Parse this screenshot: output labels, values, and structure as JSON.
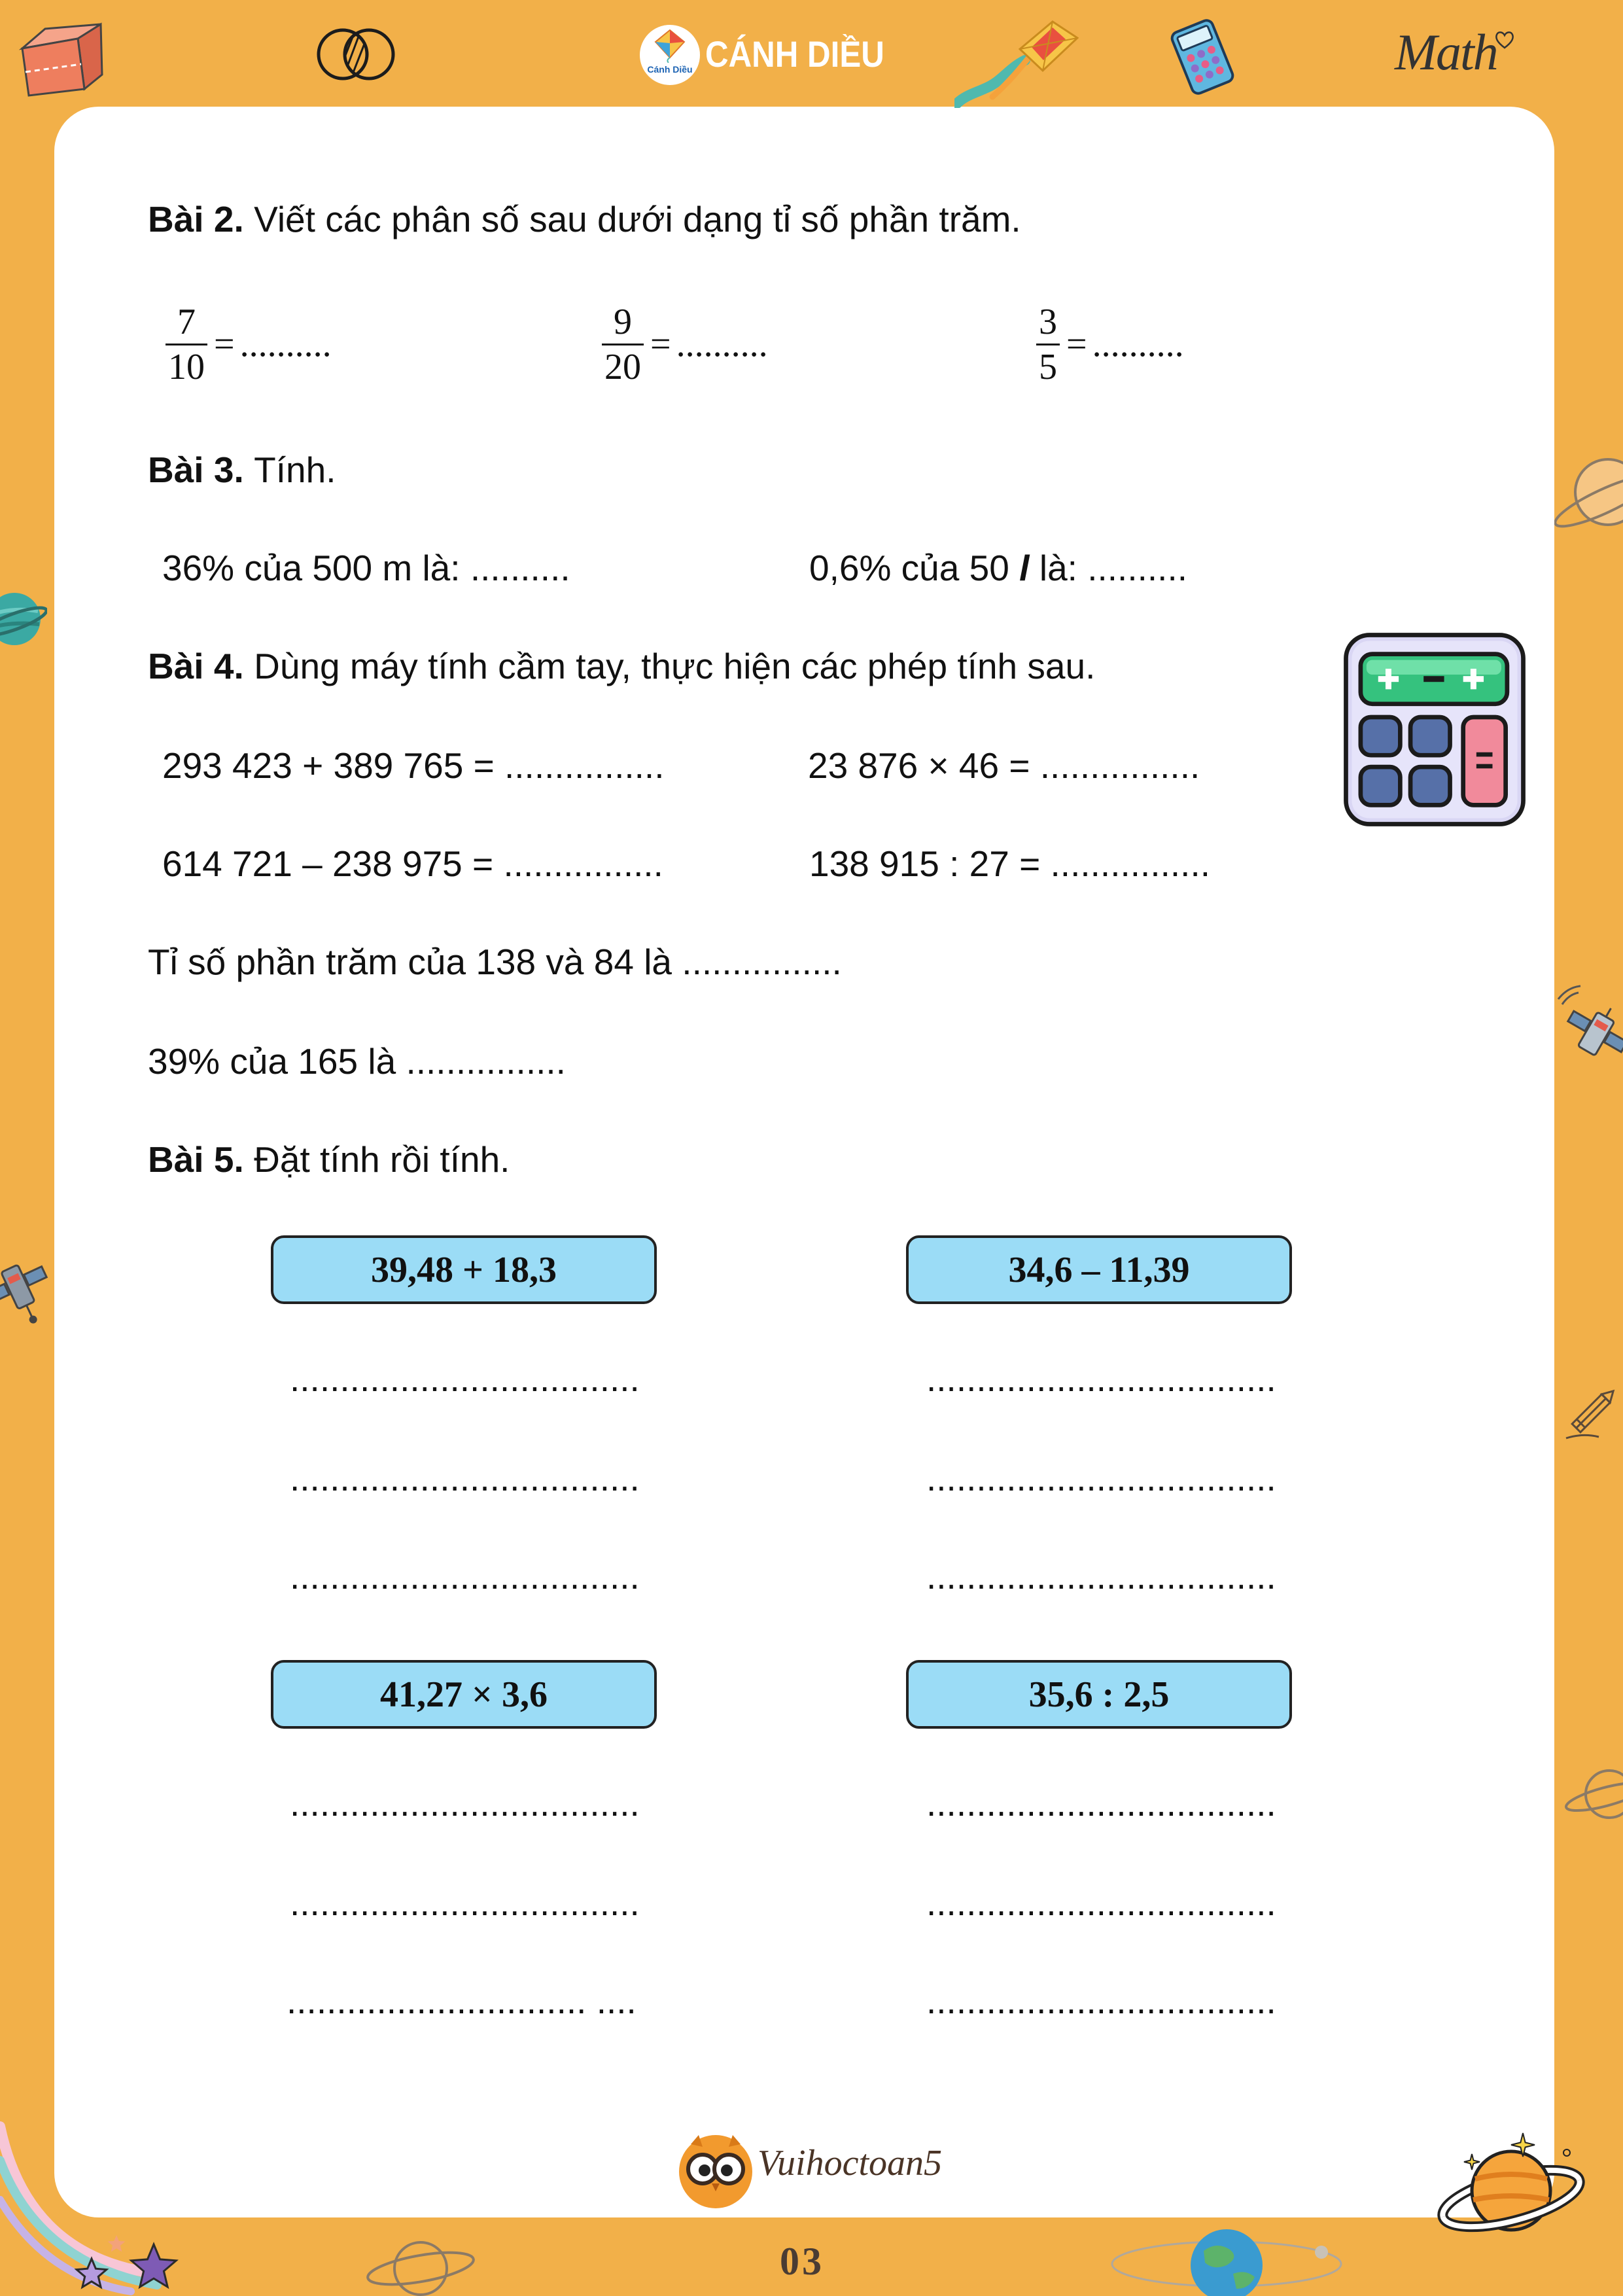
{
  "header": {
    "brand_badge": "Cánh Diều",
    "brand_name": "CÁNH DIỀU",
    "handwritten_label": "Math"
  },
  "bai2": {
    "label": "Bài 2.",
    "instruction": "Viết các phân số sau dưới dạng tỉ số phần trăm.",
    "fractions": [
      {
        "numerator": "7",
        "denominator": "10",
        "equals": "=",
        "blank": ".........."
      },
      {
        "numerator": "9",
        "denominator": "20",
        "equals": "=",
        "blank": ".........."
      },
      {
        "numerator": "3",
        "denominator": "5",
        "equals": "=",
        "blank": ".........."
      }
    ]
  },
  "bai3": {
    "label": "Bài 3.",
    "instruction": "Tính.",
    "item_1": "36% của 500 m là: ..........",
    "item_2": {
      "before_unit": "0,6% của 50",
      "unit": "l",
      "after_unit": "là: .........."
    }
  },
  "bai4": {
    "label": "Bài 4.",
    "instruction": "Dùng máy tính cầm tay, thực hiện các phép tính sau.",
    "calculations": [
      "293 423 + 389 765 = ................",
      "23 876 × 46 = ................",
      "614 721 – 238 975 = ................",
      "138 915 : 27 = ................"
    ],
    "percent_ratio": "Tỉ số phần trăm của 138 và 84 là ................",
    "percent_of": "39% của 165 là ................"
  },
  "bai5": {
    "label": "Bài 5.",
    "instruction": "Đặt tính rồi tính.",
    "problems": [
      {
        "expression": "39,48 + 18,3",
        "lines": [
          "...................................",
          "...................................",
          "..................................."
        ]
      },
      {
        "expression": "34,6 – 11,39",
        "lines": [
          "...................................",
          "...................................",
          "..................................."
        ]
      },
      {
        "expression": "41,27 × 3,6",
        "lines": [
          "...................................",
          "...................................",
          ".............................. ...."
        ]
      },
      {
        "expression": "35,6 : 2,5",
        "lines": [
          "...................................",
          "...................................",
          "..................................."
        ]
      }
    ]
  },
  "footer": {
    "brand": "Vuihoctoan5",
    "page_number": "03"
  },
  "icons": {
    "header": [
      "rectangular-prism-icon",
      "venn-diagram-icon",
      "kite-logo-icon",
      "kite-icon",
      "calculator-icon",
      "heart-icon"
    ],
    "exercise": "calculator-icon",
    "footer": "owl-logo-icon",
    "decorations": [
      "saturn-outline-icon",
      "teal-planet-icon",
      "satellite-icon",
      "pencil-icon",
      "comet-stars-icon",
      "saturn-icon",
      "earth-icon"
    ]
  },
  "colors": {
    "page_background": "#F2B049",
    "panel": "#FFFFFF",
    "problem_box": "#9BDCF6",
    "text": "#111111",
    "page_number": "#4A3C33"
  }
}
